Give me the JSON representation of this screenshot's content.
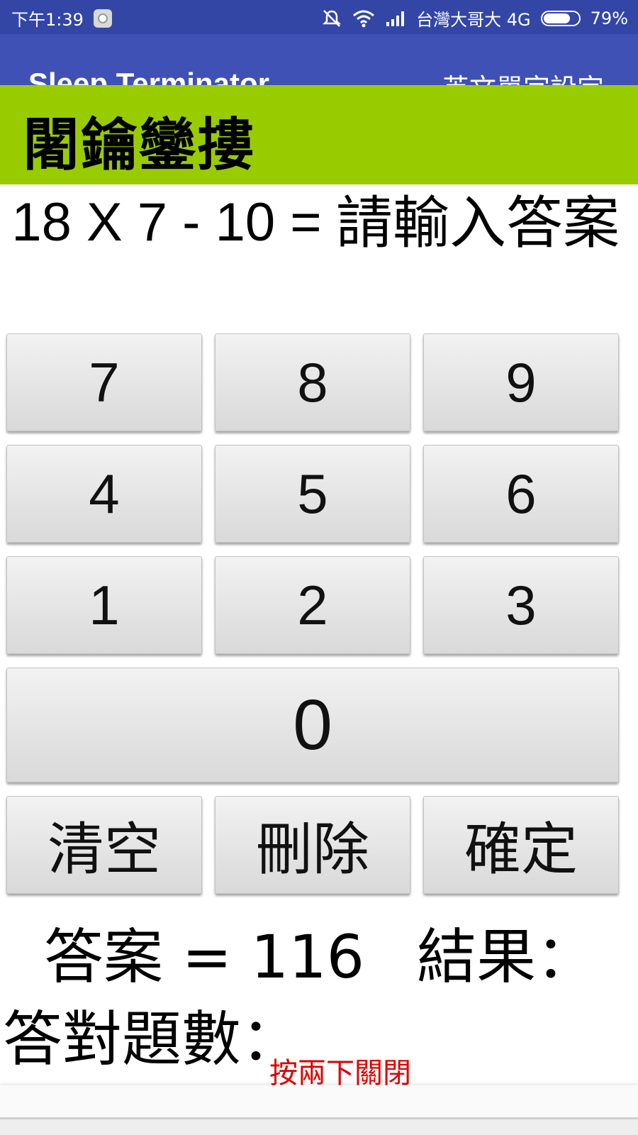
{
  "status_bar": {
    "time": "下午1:39",
    "carrier": "台灣大哥大 4G",
    "battery": "79%",
    "battery_level": 0.79,
    "icons": [
      "app-notification-icon",
      "mute-vibrate-icon",
      "wifi-icon",
      "signal-icon",
      "battery-icon"
    ]
  },
  "app_bar": {
    "title": "Sleep Terminator",
    "menu_label": "英文單字設定"
  },
  "banner": {
    "text": "闍鑰鑾摟",
    "color": "#99cc00"
  },
  "question": {
    "expression": "18 X 7 - 10 =",
    "prompt": "請輸入答案"
  },
  "keypad": {
    "rows": [
      [
        "7",
        "8",
        "9"
      ],
      [
        "4",
        "5",
        "6"
      ],
      [
        "1",
        "2",
        "3"
      ]
    ],
    "zero": "0",
    "clear": "清空",
    "delete": "刪除",
    "confirm": "確定"
  },
  "results": {
    "answer": "答案 = 116",
    "result": "結果：",
    "correct_count": "答對題數：",
    "footer_text": "按兩下關閉"
  },
  "colors": {
    "status_bar": "#3346a6",
    "app_bar": "#3f51b5",
    "footer_text": "#e00000"
  }
}
